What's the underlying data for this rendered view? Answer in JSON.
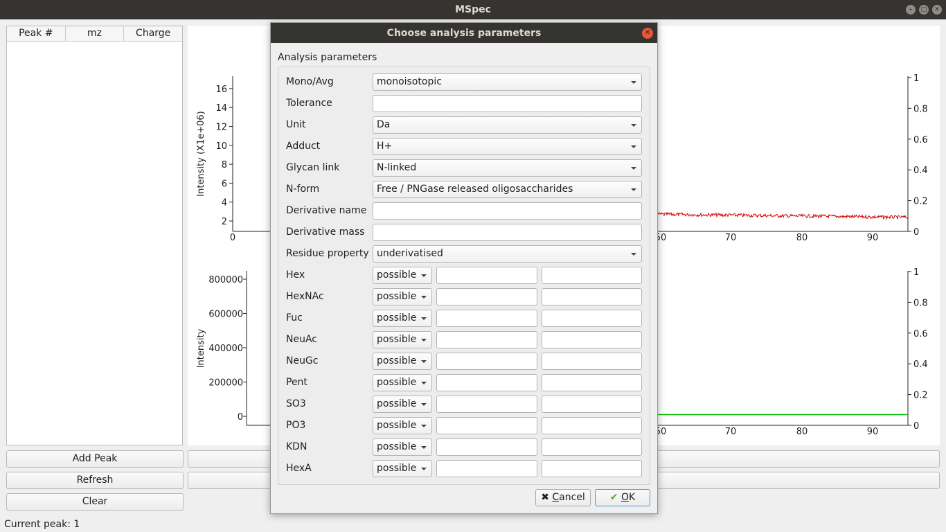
{
  "window": {
    "title": "MSpec"
  },
  "peak_table": {
    "columns": [
      "Peak #",
      "mz",
      "Charge"
    ]
  },
  "left_buttons": {
    "add_peak": "Add Peak",
    "refresh": "Refresh",
    "clear": "Clear"
  },
  "status": {
    "current_peak": "Current peak: 1"
  },
  "colors": {
    "top_series": "#d40000",
    "bottom_series": "#00c000",
    "titlebar": "#353431",
    "close": "#e4583a"
  },
  "chart_data": [
    {
      "type": "line",
      "title": "",
      "xlabel": "",
      "ylabel": "Intensity (X1e+06)",
      "left_yticks": [
        "2",
        "4",
        "6",
        "8",
        "10",
        "12",
        "14",
        "16"
      ],
      "right_yticks": [
        "0",
        "0.2",
        "0.4",
        "0.6",
        "0.8",
        "1"
      ],
      "xticks_visible": [
        "0",
        "50",
        "70",
        "80",
        "90"
      ],
      "series_color": "#d40000",
      "visible_trace_level_right_axis": 0.1
    },
    {
      "type": "line",
      "title": "",
      "xlabel": "",
      "ylabel": "Intensity",
      "left_yticks": [
        "0",
        "200000",
        "400000",
        "600000",
        "800000"
      ],
      "right_yticks": [
        "0",
        "0.2",
        "0.4",
        "0.6",
        "0.8",
        "1"
      ],
      "xticks_visible": [
        "50",
        "70",
        "80",
        "90"
      ],
      "series_color": "#00c000",
      "visible_trace_level_right_axis": 0.07
    }
  ],
  "dialog": {
    "title": "Choose analysis parameters",
    "group_label": "Analysis parameters",
    "fields": {
      "mono_avg": {
        "label": "Mono/Avg",
        "value": "monoisotopic"
      },
      "tolerance": {
        "label": "Tolerance",
        "value": ""
      },
      "unit": {
        "label": "Unit",
        "value": "Da"
      },
      "adduct": {
        "label": "Adduct",
        "value": "H+"
      },
      "glycan_link": {
        "label": "Glycan link",
        "value": "N-linked"
      },
      "n_form": {
        "label": "N-form",
        "value": "Free / PNGase released oligosaccharides"
      },
      "derivative_name": {
        "label": "Derivative name",
        "value": ""
      },
      "derivative_mass": {
        "label": "Derivative mass",
        "value": ""
      },
      "residue_property": {
        "label": "Residue property",
        "value": "underivatised"
      }
    },
    "residues": [
      {
        "label": "Hex",
        "option": "possible",
        "min": "",
        "max": ""
      },
      {
        "label": "HexNAc",
        "option": "possible",
        "min": "",
        "max": ""
      },
      {
        "label": "Fuc",
        "option": "possible",
        "min": "",
        "max": ""
      },
      {
        "label": "NeuAc",
        "option": "possible",
        "min": "",
        "max": ""
      },
      {
        "label": "NeuGc",
        "option": "possible",
        "min": "",
        "max": ""
      },
      {
        "label": "Pent",
        "option": "possible",
        "min": "",
        "max": ""
      },
      {
        "label": "SO3",
        "option": "possible",
        "min": "",
        "max": ""
      },
      {
        "label": "PO3",
        "option": "possible",
        "min": "",
        "max": ""
      },
      {
        "label": "KDN",
        "option": "possible",
        "min": "",
        "max": ""
      },
      {
        "label": "HexA",
        "option": "possible",
        "min": "",
        "max": ""
      }
    ],
    "buttons": {
      "cancel_mnemonic": "C",
      "cancel_rest": "ancel",
      "ok_mnemonic": "O",
      "ok_rest": "K"
    }
  }
}
